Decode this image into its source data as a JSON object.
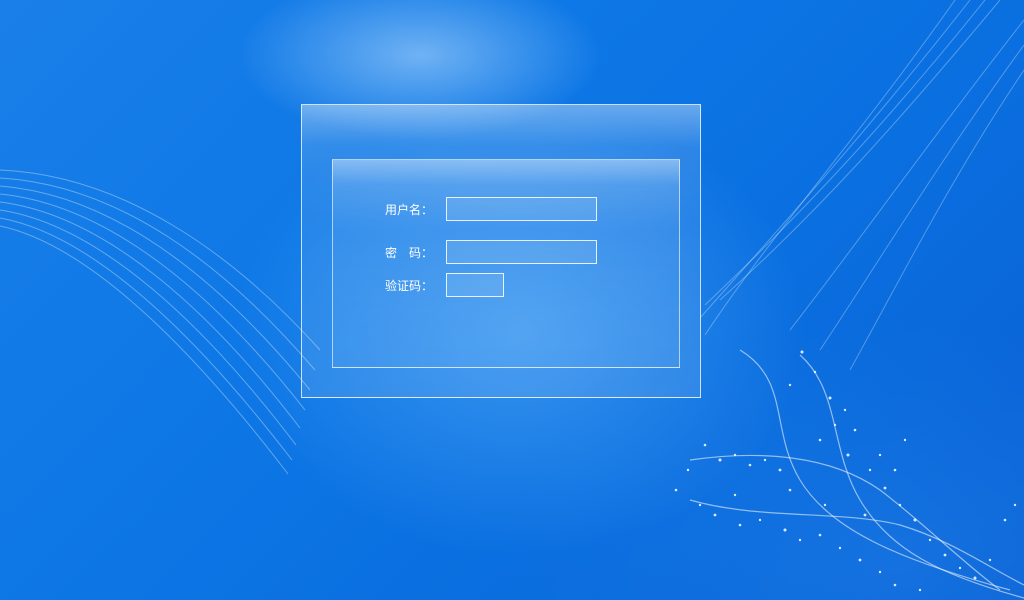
{
  "login_form": {
    "username": {
      "label": "用户名：",
      "value": ""
    },
    "password": {
      "label": "密　码：",
      "value": ""
    },
    "captcha": {
      "label": "验证码：",
      "value": ""
    }
  },
  "colors": {
    "background": "#0e78e6",
    "text": "#ffffff",
    "panel_border": "#ffffff"
  }
}
